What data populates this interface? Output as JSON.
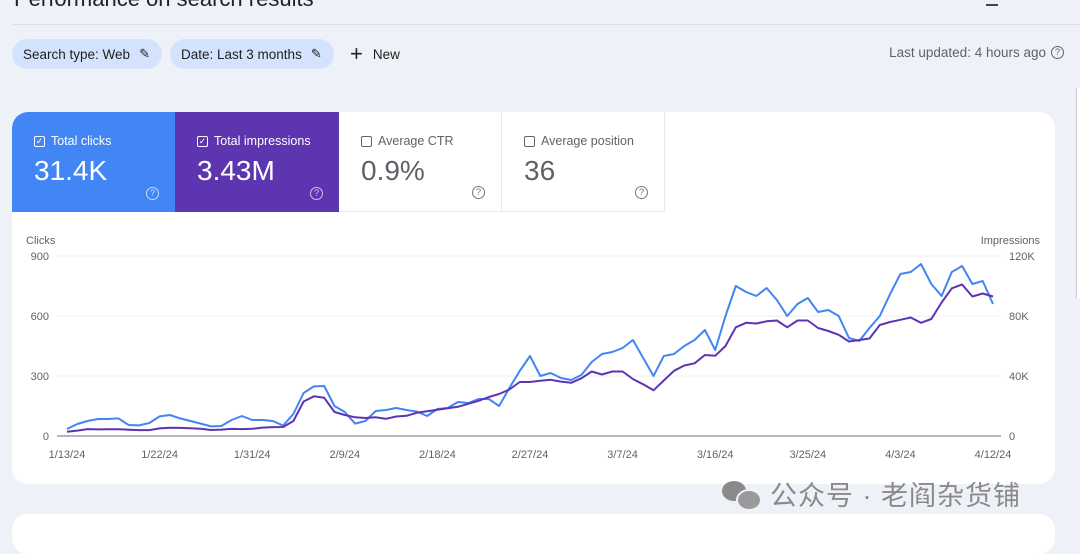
{
  "header": {
    "title": "Performance on search results",
    "filters": [
      {
        "label": "Search type: Web"
      },
      {
        "label": "Date: Last 3 months"
      }
    ],
    "new_label": "New",
    "last_updated": "Last updated: 4 hours ago"
  },
  "metrics": [
    {
      "label": "Total clicks",
      "value": "31.4K",
      "checked": true,
      "color": "#4285f4"
    },
    {
      "label": "Total impressions",
      "value": "3.43M",
      "checked": true,
      "color": "#5e35b1"
    },
    {
      "label": "Average CTR",
      "value": "0.9%",
      "checked": false
    },
    {
      "label": "Average position",
      "value": "36",
      "checked": false
    }
  ],
  "watermark": "公众号 · 老阎杂货铺",
  "chart_data": {
    "type": "line",
    "title": "",
    "xlabel": "",
    "ylabel": "Clicks",
    "y2label": "Impressions",
    "ylim": [
      0,
      900
    ],
    "y2lim": [
      0,
      120000
    ],
    "yticks": [
      "0",
      "300",
      "600",
      "900"
    ],
    "y2ticks": [
      "0",
      "40K",
      "80K",
      "120K"
    ],
    "grid": true,
    "legend": "none",
    "x_start": "1/13/24",
    "x_end": "4/12/24",
    "xtick_labels": [
      "1/13/24",
      "1/22/24",
      "1/31/24",
      "2/9/24",
      "2/18/24",
      "2/27/24",
      "3/7/24",
      "3/16/24",
      "3/25/24",
      "4/3/24",
      "4/12/24"
    ],
    "xtick_index": [
      0,
      9,
      18,
      27,
      36,
      45,
      54,
      63,
      72,
      81,
      90
    ],
    "series": [
      {
        "name": "Clicks",
        "axis": "left",
        "color": "#4285f4",
        "values": [
          35,
          60,
          75,
          85,
          85,
          88,
          55,
          53,
          65,
          98,
          105,
          88,
          75,
          62,
          48,
          50,
          80,
          100,
          80,
          80,
          75,
          52,
          110,
          215,
          248,
          250,
          150,
          120,
          62,
          75,
          125,
          130,
          140,
          130,
          122,
          100,
          135,
          140,
          170,
          165,
          185,
          185,
          150,
          240,
          325,
          400,
          300,
          315,
          290,
          280,
          305,
          370,
          410,
          420,
          440,
          480,
          390,
          300,
          400,
          410,
          450,
          480,
          530,
          430,
          600,
          750,
          720,
          700,
          740,
          680,
          600,
          660,
          690,
          620,
          630,
          600,
          490,
          475,
          540,
          600,
          710,
          810,
          820,
          860,
          760,
          700,
          820,
          850,
          760,
          775,
          660
        ]
      },
      {
        "name": "Impressions",
        "axis": "right",
        "color": "#5e35b1",
        "values": [
          2800,
          3600,
          4600,
          4400,
          4500,
          4500,
          4200,
          3900,
          3900,
          5100,
          5500,
          5400,
          5200,
          4800,
          4000,
          4300,
          4700,
          4600,
          4800,
          5600,
          5900,
          6000,
          10000,
          23000,
          26500,
          25500,
          16000,
          14000,
          12500,
          12000,
          12500,
          11500,
          13000,
          13500,
          15500,
          16500,
          17500,
          18500,
          19500,
          21500,
          23500,
          26000,
          28000,
          31000,
          36000,
          36000,
          36800,
          37500,
          36300,
          35500,
          38500,
          43000,
          41000,
          43000,
          43000,
          38000,
          34500,
          30500,
          37000,
          43500,
          47000,
          48500,
          54000,
          53500,
          60000,
          72500,
          75500,
          75000,
          76500,
          77000,
          72500,
          77000,
          77000,
          72000,
          70000,
          67500,
          63000,
          64000,
          65000,
          74000,
          76000,
          77500,
          79000,
          75500,
          78000,
          89000,
          98500,
          101000,
          93000,
          95000,
          93000
        ]
      }
    ]
  }
}
